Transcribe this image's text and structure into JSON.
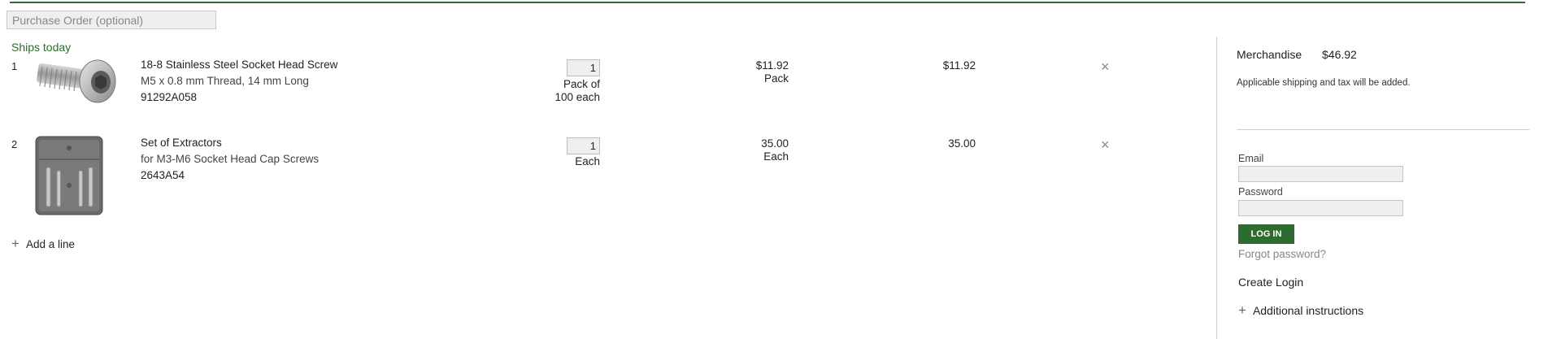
{
  "purchase_order": {
    "placeholder": "Purchase Order (optional)"
  },
  "ships_today_label": "Ships today",
  "lines": [
    {
      "number": "1",
      "image_icon": "socket-head-screw-icon",
      "name": "18-8 Stainless Steel Socket Head Screw",
      "spec": "M5 x 0.8 mm Thread, 14 mm Long",
      "part_number": "91292A058",
      "quantity": "1",
      "unit_line1": "Pack of",
      "unit_line2": "100 each",
      "price": "$11.92",
      "price_unit": "Pack",
      "total": "$11.92",
      "remove_glyph": "×"
    },
    {
      "number": "2",
      "image_icon": "extractor-set-icon",
      "name": "Set of Extractors",
      "spec": "for M3-M6 Socket Head Cap Screws",
      "part_number": "2643A54",
      "quantity": "1",
      "unit_line1": "Each",
      "unit_line2": "",
      "price": "35.00",
      "price_unit": "Each",
      "total": "35.00",
      "remove_glyph": "×"
    }
  ],
  "add_line": {
    "icon": "+",
    "label": "Add a line"
  },
  "summary": {
    "merchandise_label": "Merchandise",
    "merchandise_value": "$46.92",
    "shipping_note": "Applicable shipping and tax will be added."
  },
  "login": {
    "email_label": "Email",
    "email_value": "",
    "password_label": "Password",
    "password_value": "",
    "button_label": "LOG IN",
    "forgot_label": "Forgot password?",
    "create_login_label": "Create Login"
  },
  "additional_instructions": {
    "icon": "+",
    "label": "Additional instructions"
  },
  "colors": {
    "accent": "#2e6b2e",
    "input_bg": "#efefef",
    "divider": "#cfcfcf"
  }
}
